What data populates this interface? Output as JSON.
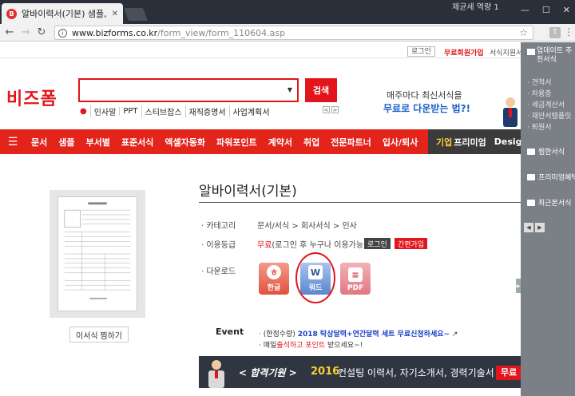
{
  "browser": {
    "tab_title": "알바이력서(기본) 샘플, 양",
    "tab_favicon": "B",
    "tab_close": "✕",
    "window_owner": "제균세 역량 1",
    "window_controls": [
      "—",
      "☐",
      "✕"
    ],
    "back": "←",
    "forward": "→",
    "reload": "↻",
    "url_host": "www.bizforms.co.kr",
    "url_path": "/form_view/form_110604.asp",
    "ext_label": "T",
    "menu": "⋮"
  },
  "util_bar": {
    "login": "로그인",
    "free_join": "무료회원가입",
    "form_request": "서식지원서비스"
  },
  "header": {
    "logo": "비즈폼",
    "search_placeholder": "",
    "search_button": "검색",
    "search_caret": "▼",
    "keywords": [
      "인사말",
      "PPT",
      "스티브잡스",
      "재직증명서",
      "사업계획서"
    ],
    "kw_prev": "<",
    "kw_next": ">"
  },
  "banner": {
    "line1": "매주마다 최신서식을",
    "line2_blue": "무료로 다운받는 법?!"
  },
  "gnb": {
    "items": [
      "문서",
      "샘플",
      "부서별",
      "표준서식",
      "엑셀자동화",
      "파워포인트",
      "계약서",
      "취업",
      "전문파트너",
      "입사/퇴사"
    ],
    "premium_a": "기업",
    "premium_b": "프리미엄",
    "design": "Design"
  },
  "preview": {
    "bookmark_button": "이서식 찜하기"
  },
  "detail": {
    "title": "알바이력서(기본)",
    "category_label": "· 카테고리",
    "category_value": "문서/서식 > 회사서식 > 인사",
    "grade_label": "· 이용등급",
    "grade_free": "무료",
    "grade_note": "(로그인 후 누구나 이용가능)",
    "login_button": "로그인",
    "simple_join_button": "간편가입",
    "download_label": "· 다운로드",
    "downloads": {
      "hwp": "한글",
      "word": "워드",
      "pdf": "PDF"
    }
  },
  "event": {
    "label": "Event",
    "line1_a": "· (한정수량)",
    "line1_b": "2018 탁상달력+연간달력 세트 무료신청하세요~",
    "line2_a": "· 매일",
    "line2_b": "출석하고 포인트",
    "line2_c": "받으세요~!"
  },
  "promo": {
    "tag": "< 합격기원 >",
    "year": "2016",
    "text": "컨설팅 이력서, 자기소개서, 경력기술서",
    "button": "무료"
  },
  "side_panel": {
    "header_title": "업데이트 추천서식",
    "links": [
      "· 견적서",
      "· 차용증",
      "· 세금계산서",
      "· 재안서템플릿",
      "· 퇴원서"
    ],
    "sections": [
      "찜한서식",
      "프리미엄혜택",
      "최근본서식"
    ],
    "prev": "◀",
    "next": "▶"
  },
  "colors": {
    "brand_red": "#e2151c",
    "gnb_red": "#e2241b",
    "side_gray": "#7b7f86",
    "accent_blue": "#1960c8"
  }
}
